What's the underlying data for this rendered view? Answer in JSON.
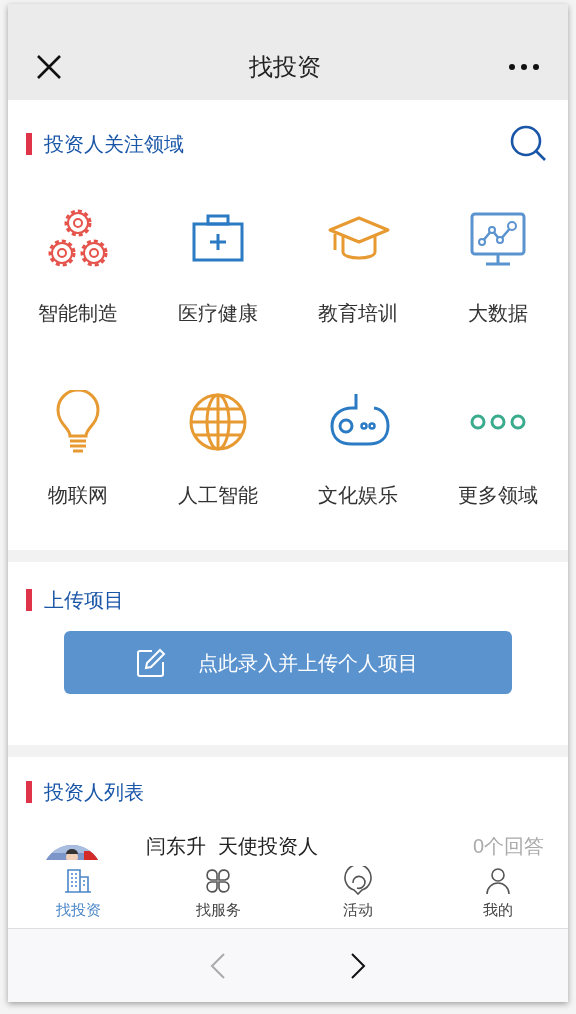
{
  "header": {
    "title": "找投资"
  },
  "fields_section": {
    "title": "投资人关注领域",
    "items": [
      {
        "label": "智能制造",
        "color": "#e5534b"
      },
      {
        "label": "医疗健康",
        "color": "#2a7ac4"
      },
      {
        "label": "教育培训",
        "color": "#e89a32"
      },
      {
        "label": "大数据",
        "color": "#5b93cf"
      },
      {
        "label": "物联网",
        "color": "#e89a32"
      },
      {
        "label": "人工智能",
        "color": "#e89a32"
      },
      {
        "label": "文化娱乐",
        "color": "#2a7ac4"
      },
      {
        "label": "更多领域",
        "color": "#3aab8c"
      }
    ]
  },
  "upload_section": {
    "title": "上传项目",
    "button": "点此录入并上传个人项目"
  },
  "investors_section": {
    "title": "投资人列表",
    "rows": [
      {
        "name": "闫东升",
        "role": "天使投资人",
        "answers": "0个回答"
      }
    ]
  },
  "tab_bar": [
    {
      "label": "找投资",
      "selected": true
    },
    {
      "label": "找服务",
      "selected": false
    },
    {
      "label": "活动",
      "selected": false
    },
    {
      "label": "我的",
      "selected": false
    }
  ],
  "browser_nav": {
    "back_disabled": true,
    "forward_disabled": false
  }
}
